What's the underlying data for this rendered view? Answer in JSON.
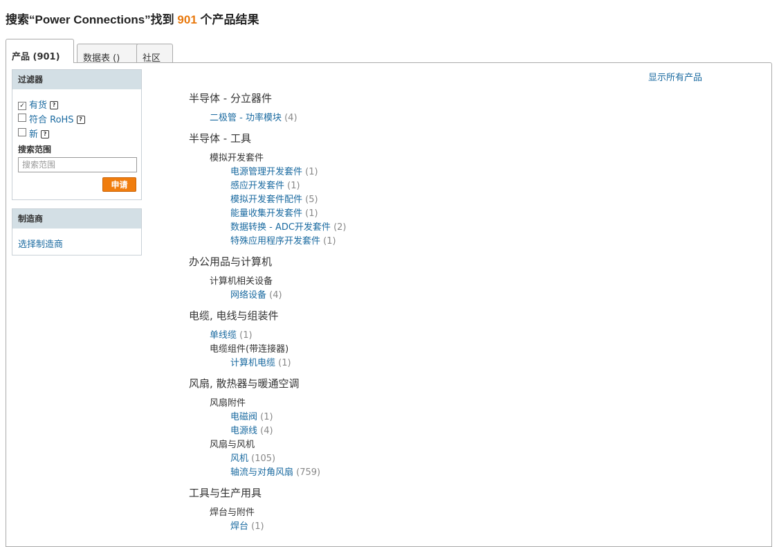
{
  "header": {
    "prefix": "搜索“Power Connections”找到 ",
    "count": "901",
    "suffix": " 个产品结果"
  },
  "tabs": {
    "products": "产品 (901)",
    "datasheets": "数据表 ()",
    "community": "社区"
  },
  "filter": {
    "title": "过滤器",
    "in_stock": "有货",
    "rohs": "符合 RoHS",
    "new": "新",
    "help_glyph": "?",
    "check_glyph": "✓",
    "scope_label": "搜索范围",
    "scope_placeholder": "搜索范围",
    "apply": "申请"
  },
  "manufacturer": {
    "title": "制造商",
    "select_link": "选择制造商"
  },
  "show_all": "显示所有产品",
  "results": {
    "c1": "半导体 - 分立器件",
    "c1_l1": "二极管 - 功率模块",
    "c1_l1_n": "(4)",
    "c2": "半导体 - 工具",
    "c2_s1": "模拟开发套件",
    "c2_l1": "电源管理开发套件",
    "c2_l1_n": "(1)",
    "c2_l2": "感应开发套件",
    "c2_l2_n": "(1)",
    "c2_l3": "模拟开发套件配件",
    "c2_l3_n": "(5)",
    "c2_l4": "能量收集开发套件",
    "c2_l4_n": "(1)",
    "c2_l5": "数据转换 - ADC开发套件",
    "c2_l5_n": "(2)",
    "c2_l6": "特殊应用程序开发套件",
    "c2_l6_n": "(1)",
    "c3": "办公用品与计算机",
    "c3_s1": "计算机相关设备",
    "c3_l1": "网络设备",
    "c3_l1_n": "(4)",
    "c4": "电缆, 电线与组装件",
    "c4_l1": "单线缆",
    "c4_l1_n": "(1)",
    "c4_s1": "电缆组件(带连接器)",
    "c4_l2": "计算机电缆",
    "c4_l2_n": "(1)",
    "c5": "风扇, 散热器与暖通空调",
    "c5_s1": "风扇附件",
    "c5_l1": "电磁阀",
    "c5_l1_n": "(1)",
    "c5_l2": "电源线",
    "c5_l2_n": "(4)",
    "c5_s2": "风扇与风机",
    "c5_l3": "风机",
    "c5_l3_n": "(105)",
    "c5_l4": "轴流与对角风扇",
    "c5_l4_n": "(759)",
    "c6": "工具与生产用具",
    "c6_s1": "焊台与附件",
    "c6_l1": "焊台",
    "c6_l1_n": "(1)"
  }
}
